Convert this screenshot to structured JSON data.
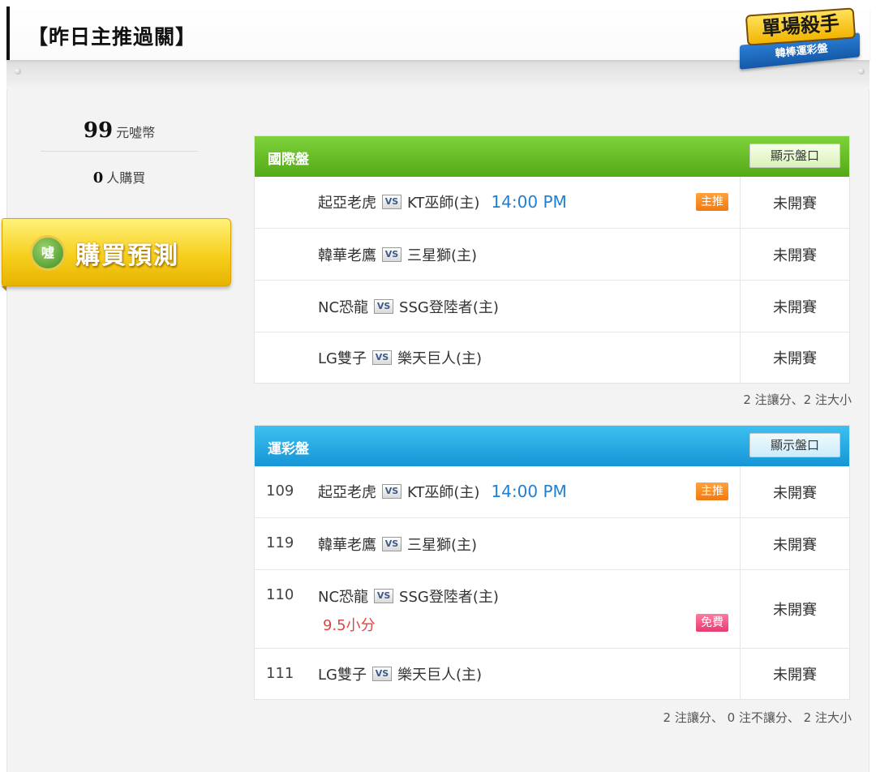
{
  "header": {
    "title": "【昨日主推過關】",
    "badge_main": "單場殺手",
    "badge_sub": "韓棒運彩盤"
  },
  "sidebar": {
    "price_value": "99",
    "price_unit": "元噓幣",
    "buyers_value": "0",
    "buyers_unit": "人購買",
    "buy_icon": "噓",
    "buy_label": "購買預測"
  },
  "panels": [
    {
      "title": "國際盤",
      "show_label": "顯示盤口",
      "summary": "2 注讓分、2 注大小",
      "rows": [
        {
          "num": "",
          "home": "起亞老虎",
          "vs": "VS",
          "away": "KT巫師(主)",
          "time": "14:00 PM",
          "tag": "主推",
          "status": "未開賽"
        },
        {
          "num": "",
          "home": "韓華老鷹",
          "vs": "VS",
          "away": "三星獅(主)",
          "time": "",
          "tag": "",
          "status": "未開賽"
        },
        {
          "num": "",
          "home": "NC恐龍",
          "vs": "VS",
          "away": "SSG登陸者(主)",
          "time": "",
          "tag": "",
          "status": "未開賽"
        },
        {
          "num": "",
          "home": "LG雙子",
          "vs": "VS",
          "away": "樂天巨人(主)",
          "time": "",
          "tag": "",
          "status": "未開賽"
        }
      ]
    },
    {
      "title": "運彩盤",
      "show_label": "顯示盤口",
      "summary": "2 注讓分、 0 注不讓分、 2 注大小",
      "rows": [
        {
          "num": "109",
          "home": "起亞老虎",
          "vs": "VS",
          "away": "KT巫師(主)",
          "time": "14:00 PM",
          "tag": "主推",
          "status": "未開賽"
        },
        {
          "num": "119",
          "home": "韓華老鷹",
          "vs": "VS",
          "away": "三星獅(主)",
          "time": "",
          "tag": "",
          "status": "未開賽"
        },
        {
          "num": "110",
          "home": "NC恐龍",
          "vs": "VS",
          "away": "SSG登陸者(主)",
          "time": "",
          "pick": "9.5小分",
          "tag": "免費",
          "status": "未開賽"
        },
        {
          "num": "111",
          "home": "LG雙子",
          "vs": "VS",
          "away": "樂天巨人(主)",
          "time": "",
          "tag": "",
          "status": "未開賽"
        }
      ]
    }
  ]
}
